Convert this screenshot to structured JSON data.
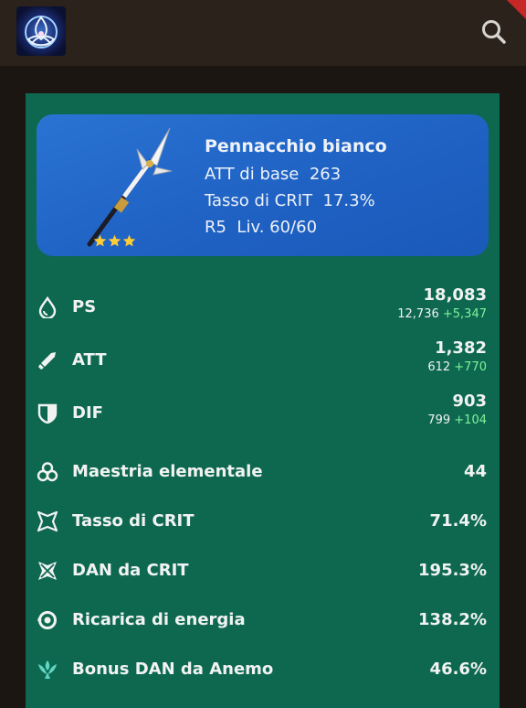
{
  "header": {
    "logo_icon": "triquetra-logo",
    "search_icon": "search-icon",
    "accent_color": "#c62828"
  },
  "weapon": {
    "name": "Pennacchio bianco",
    "base_atk_label": "ATT di base",
    "base_atk_value": "263",
    "crit_rate_label": "Tasso di CRIT",
    "crit_rate_value": "17.3%",
    "refinement": "R5",
    "level": "Liv. 60/60",
    "rarity_stars": 3,
    "icon": "polearm-icon",
    "card_color": "#2268c9"
  },
  "stats": [
    {
      "icon": "hp-droplet-icon",
      "label": "PS",
      "value": "18,083",
      "base": "12,736",
      "bonus": "+5,347"
    },
    {
      "icon": "sword-icon",
      "label": "ATT",
      "value": "1,382",
      "base": "612",
      "bonus": "+770"
    },
    {
      "icon": "shield-icon",
      "label": "DIF",
      "value": "903",
      "base": "799",
      "bonus": "+104"
    },
    {
      "icon": "elemental-mastery-icon",
      "label": "Maestria elementale",
      "value": "44"
    },
    {
      "icon": "crit-rate-icon",
      "label": "Tasso di CRIT",
      "value": "71.4%"
    },
    {
      "icon": "crit-dmg-icon",
      "label": "DAN da CRIT",
      "value": "195.3%"
    },
    {
      "icon": "energy-recharge-icon",
      "label": "Ricarica di energia",
      "value": "138.2%"
    },
    {
      "icon": "anemo-icon",
      "label": "Bonus DAN da Anemo",
      "value": "46.6%"
    }
  ],
  "colors": {
    "panel": "#0e6850",
    "bonus": "#7ef29a",
    "anemo": "#5fd5c3"
  }
}
